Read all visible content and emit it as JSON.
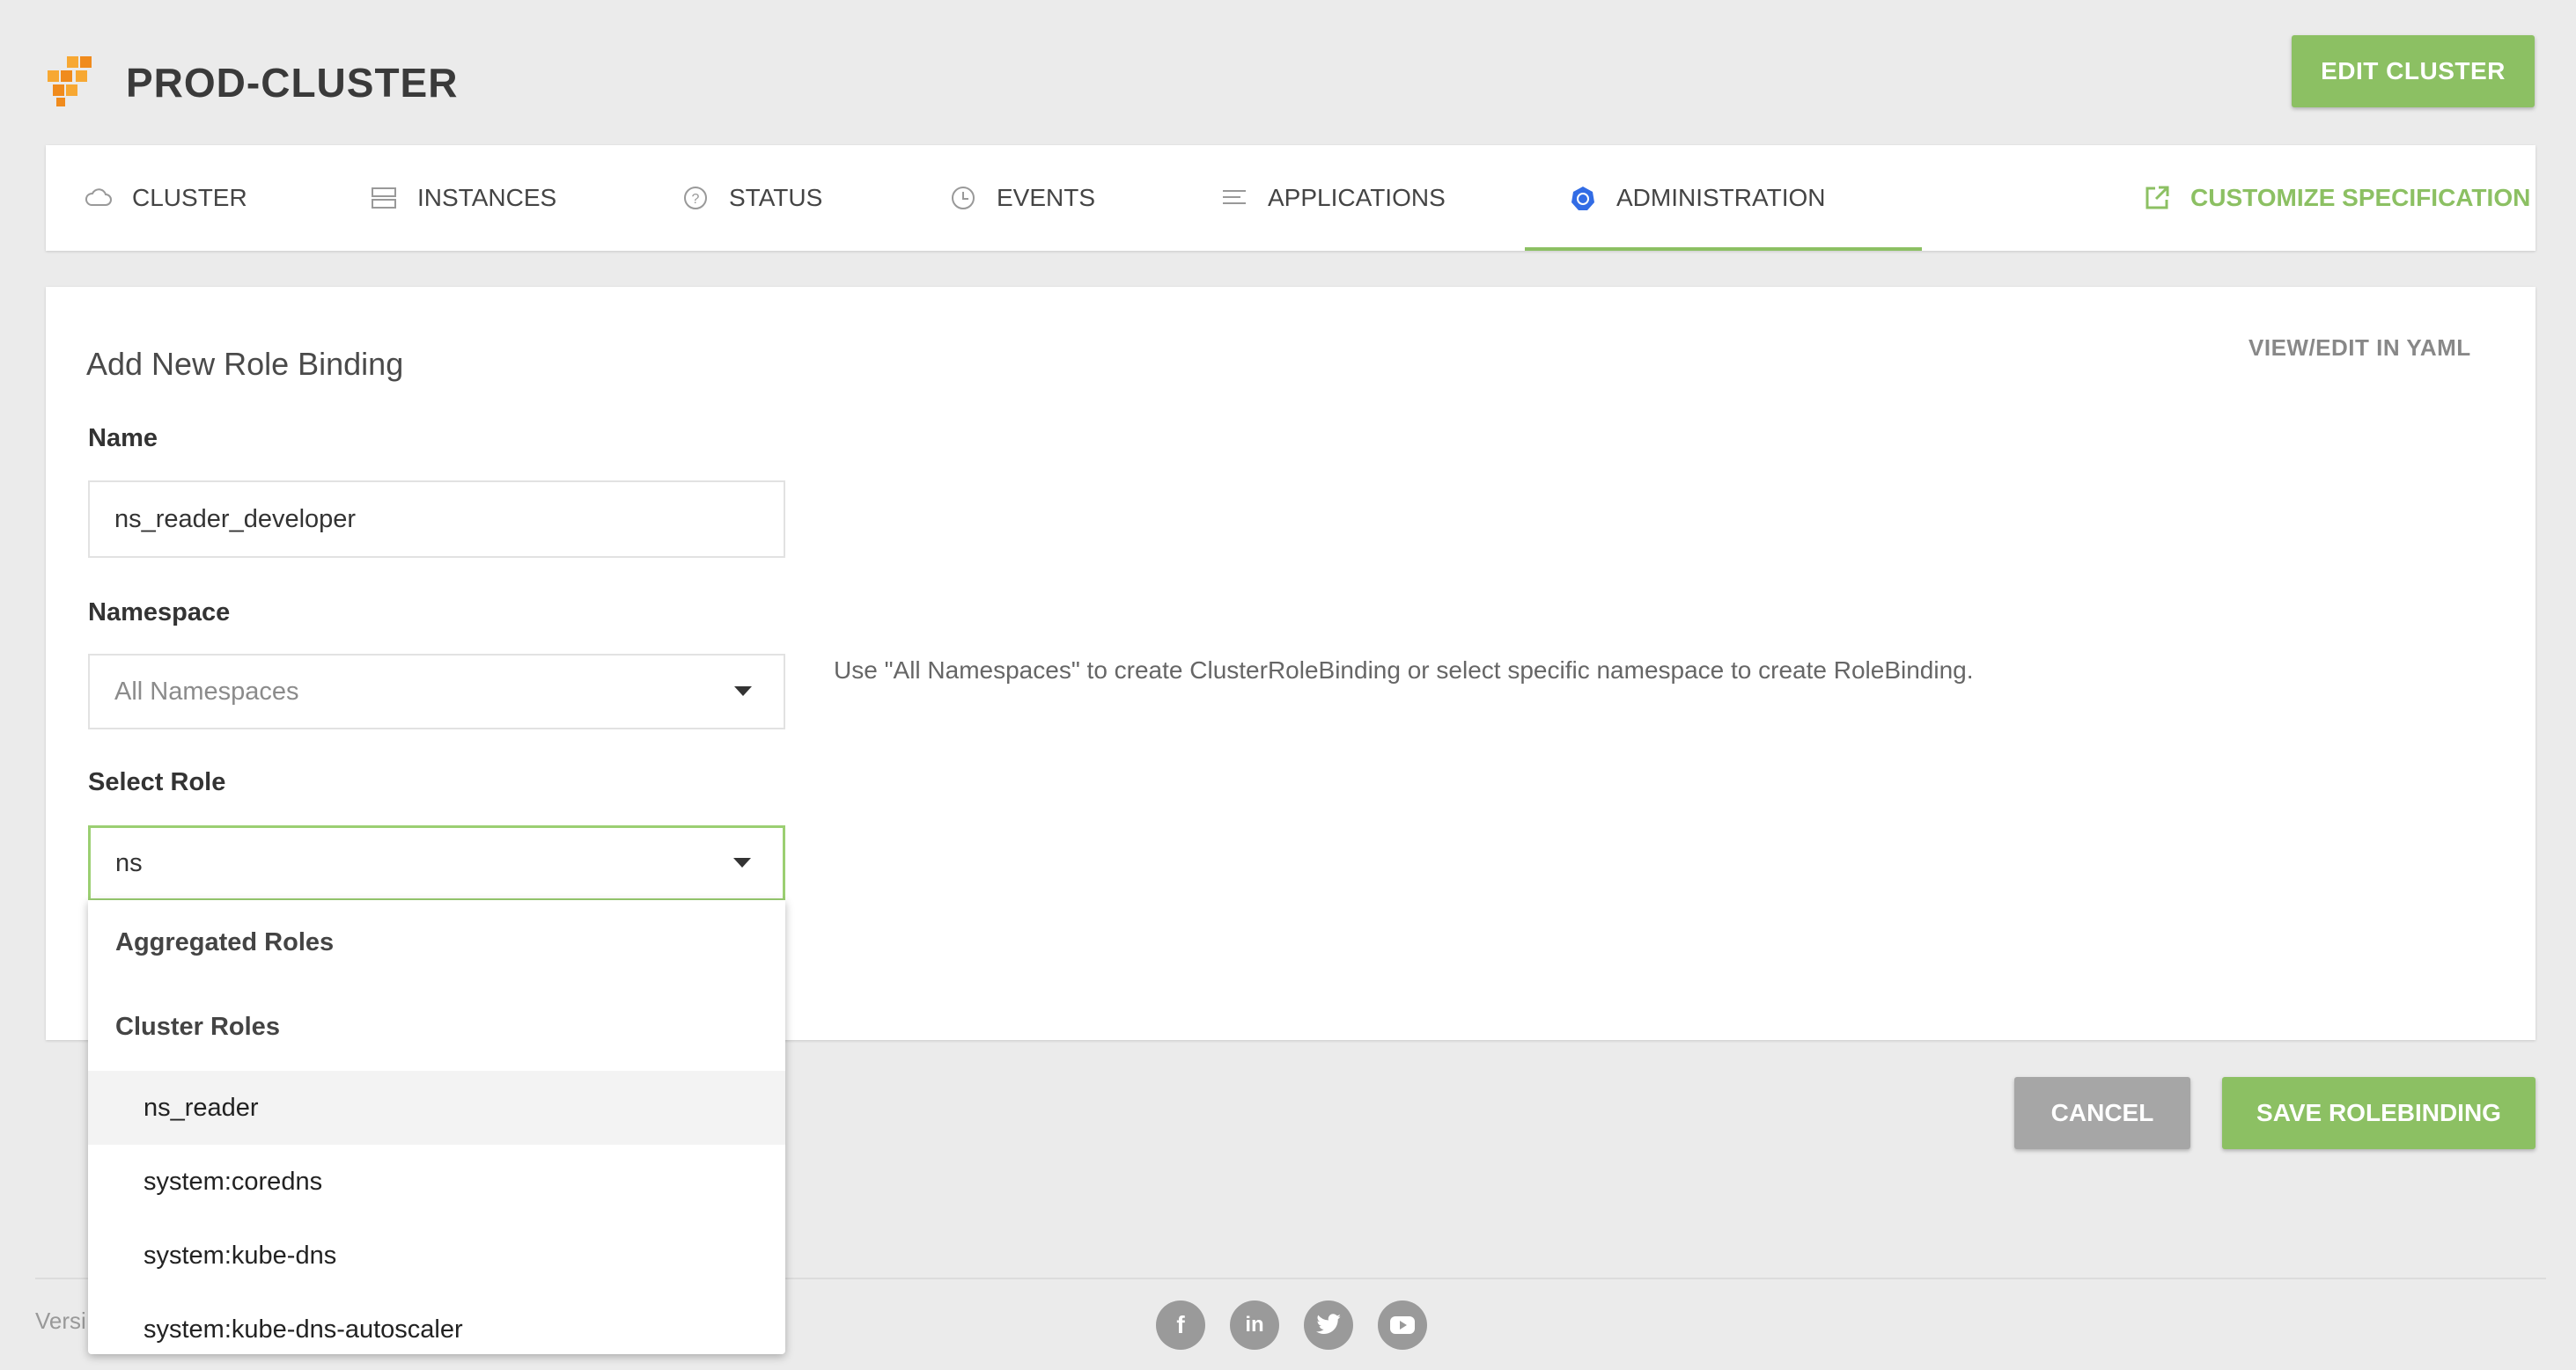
{
  "header": {
    "title": "PROD-CLUSTER",
    "edit_label": "EDIT CLUSTER"
  },
  "tabs": [
    {
      "label": "CLUSTER",
      "icon": "cloud-icon"
    },
    {
      "label": "INSTANCES",
      "icon": "server-icon"
    },
    {
      "label": "STATUS",
      "icon": "question-circle-icon"
    },
    {
      "label": "EVENTS",
      "icon": "clock-icon"
    },
    {
      "label": "APPLICATIONS",
      "icon": "list-icon"
    },
    {
      "label": "ADMINISTRATION",
      "icon": "kubernetes-wheel-icon",
      "active": true
    }
  ],
  "customize_label": "CUSTOMIZE SPECIFICATION",
  "form": {
    "title": "Add New Role Binding",
    "yaml_link": "VIEW/EDIT IN YAML",
    "name_label": "Name",
    "name_value": "ns_reader_developer",
    "namespace_label": "Namespace",
    "namespace_placeholder": "All Namespaces",
    "namespace_hint": "Use \"All Namespaces\" to create ClusterRoleBinding or select specific namespace to create RoleBinding.",
    "role_label": "Select Role",
    "role_value": "ns"
  },
  "role_menu": {
    "groups": [
      "Aggregated Roles",
      "Cluster Roles"
    ],
    "options": [
      "ns_reader",
      "system:coredns",
      "system:kube-dns",
      "system:kube-dns-autoscaler"
    ]
  },
  "actions": {
    "cancel_label": "CANCEL",
    "save_label": "SAVE ROLEBINDING"
  },
  "footer": {
    "version_text": "Versi",
    "social": [
      "facebook-icon",
      "linkedin-icon",
      "twitter-icon",
      "youtube-icon"
    ]
  },
  "colors": {
    "accent": "#8cc063",
    "background": "#ebebeb",
    "cancel": "#a6a6a6"
  }
}
